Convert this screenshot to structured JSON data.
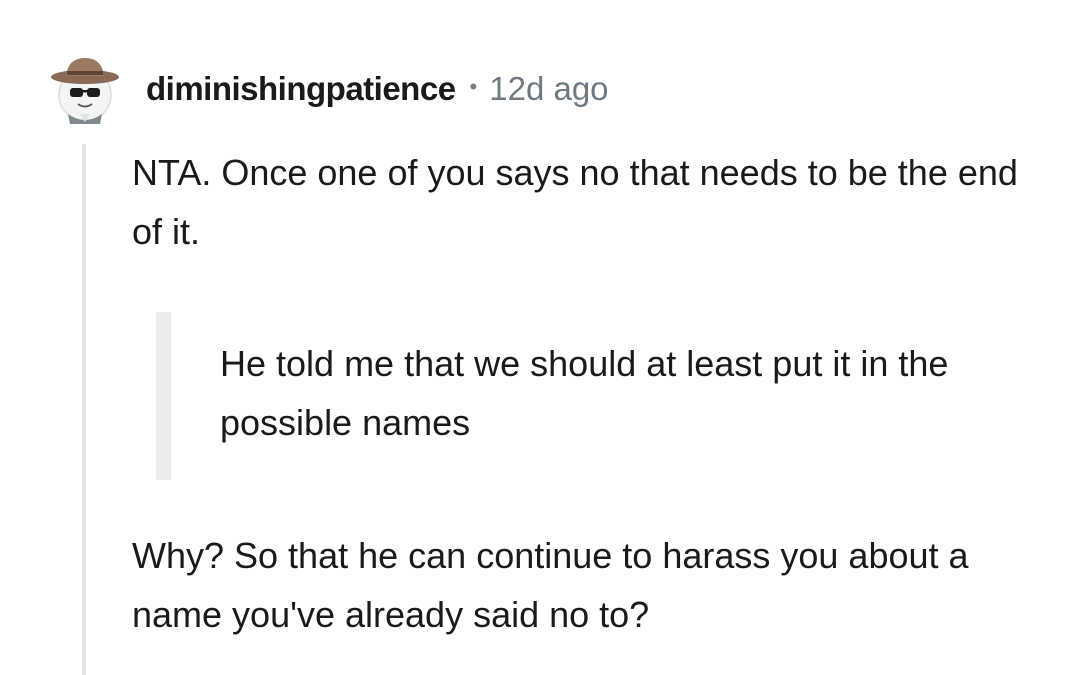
{
  "comment": {
    "username": "diminishingpatience",
    "separator": "•",
    "timestamp": "12d ago",
    "avatar_icon": "snoo-cowboy-hat-sunglasses-icon",
    "paragraphs": [
      "NTA. Once one of you says no that needs to be the end of it."
    ],
    "quote": "He told me that we should at least put it in the possible names",
    "closing": "Why? So that he can continue to harass you about a name you've already said no to?"
  },
  "colors": {
    "username": "#1a1a1b",
    "timestamp": "#6f7a80",
    "thread_line": "#e4e4e4",
    "quote_bar": "#ebebeb"
  }
}
